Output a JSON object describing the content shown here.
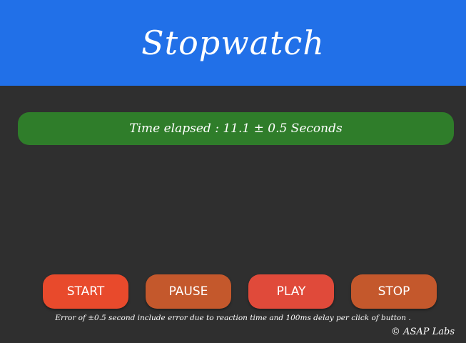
{
  "header": {
    "title": "Stopwatch"
  },
  "elapsed": {
    "text": "Time elapsed : 11.1 ± 0.5 Seconds"
  },
  "buttons": {
    "start": {
      "label": "START",
      "color": "#e84a2c"
    },
    "pause": {
      "label": "PAUSE",
      "color": "#c4582c"
    },
    "play": {
      "label": "PLAY",
      "color": "#e04a3a"
    },
    "stop": {
      "label": "STOP",
      "color": "#c4582c"
    }
  },
  "footer": {
    "note": "Error of ±0.5 second include error due to reaction time and 100ms delay per click of button .",
    "copyright": "© ASAP Labs"
  },
  "colors": {
    "header_bg": "#2170e8",
    "page_bg": "#2f2f2f",
    "elapsed_bg": "#2f7d2a"
  }
}
